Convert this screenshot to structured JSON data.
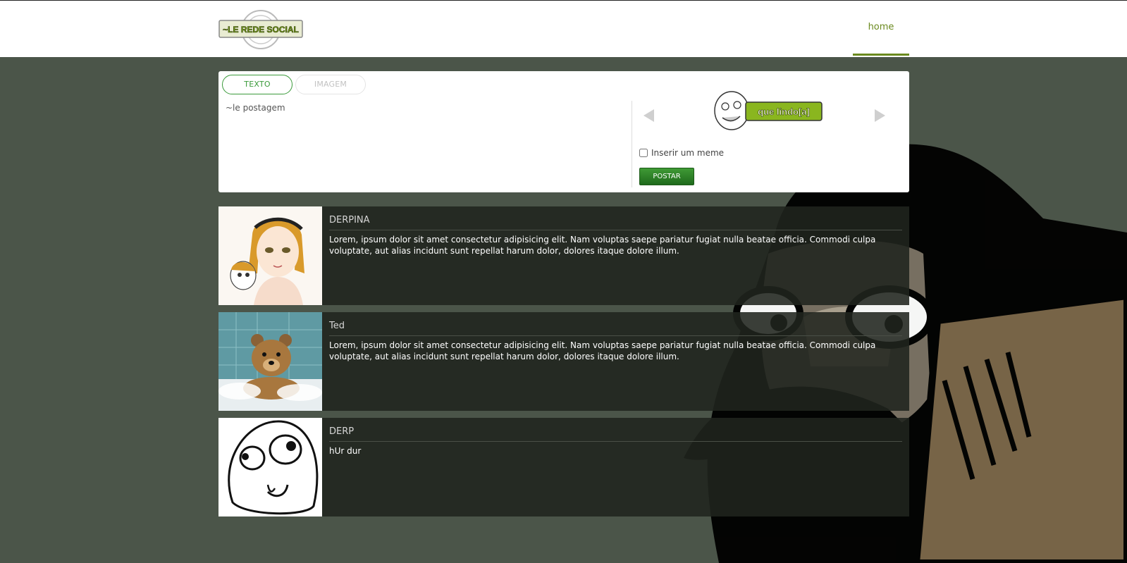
{
  "header": {
    "logo_text": "~LE REDE SOCIAL",
    "nav": {
      "home_label": "home"
    }
  },
  "composer": {
    "tabs": [
      {
        "label": "TEXTO",
        "active": true
      },
      {
        "label": "IMAGEM",
        "active": false
      }
    ],
    "textarea_placeholder": "~le postagem",
    "meme_preview_text": "que lindo[a]",
    "meme_checkbox_label": "Inserir um meme",
    "meme_checkbox_checked": false,
    "submit_label": "POSTAR"
  },
  "feed": {
    "posts": [
      {
        "author": "DERPINA",
        "avatar": "derpina-avatar",
        "text": "Lorem, ipsum dolor sit amet consectetur adipisicing elit. Nam voluptas saepe pariatur fugiat nulla beatae officia. Commodi culpa voluptate, aut alias incidunt sunt repellat harum dolor, dolores itaque dolore illum."
      },
      {
        "author": "Ted",
        "avatar": "teddy-bear-avatar",
        "text": "Lorem, ipsum dolor sit amet consectetur adipisicing elit. Nam voluptas saepe pariatur fugiat nulla beatae officia. Commodi culpa voluptate, aut alias incidunt sunt repellat harum dolor, dolores itaque dolore illum."
      },
      {
        "author": "DERP",
        "avatar": "derp-face-avatar",
        "text": "hUr dur"
      }
    ]
  },
  "colors": {
    "page_bg": "#4b5549",
    "accent_green": "#6b8a1f",
    "tab_green": "#3a9a3a",
    "button_green": "#2e8028",
    "post_bg": "#20241e"
  }
}
